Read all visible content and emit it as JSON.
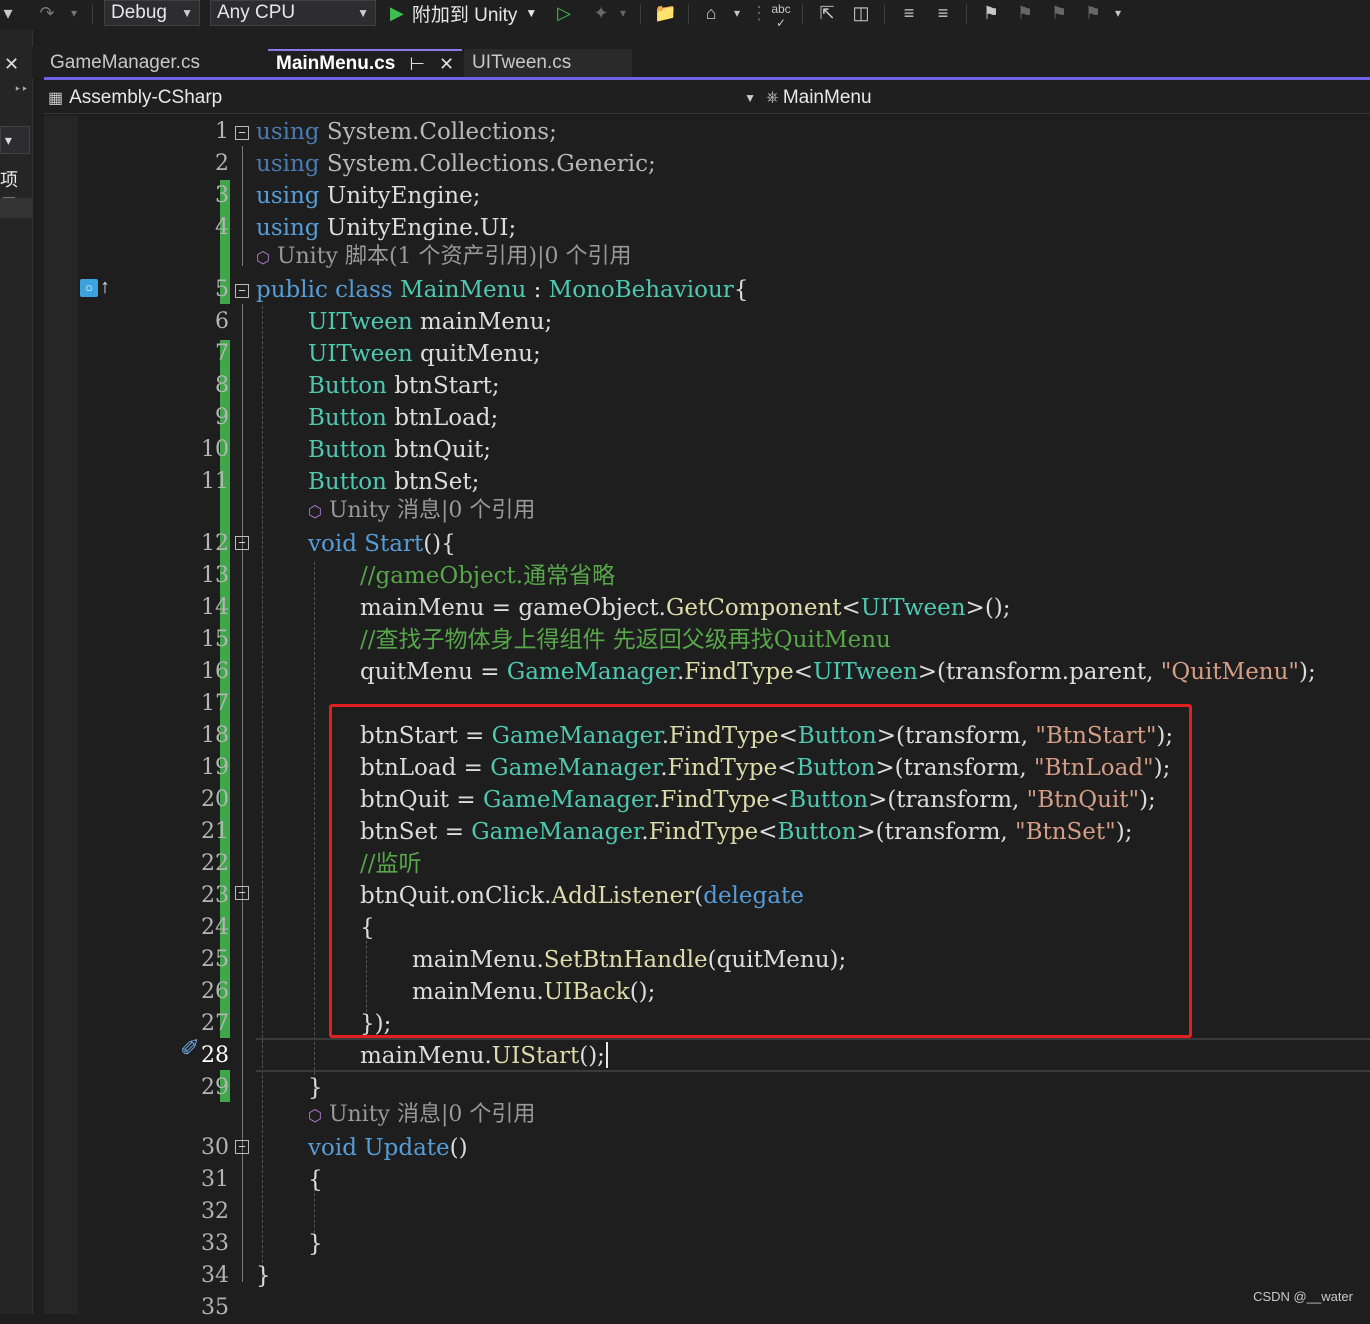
{
  "toolbar": {
    "config": "Debug",
    "platform": "Any CPU",
    "attach_label": "附加到 Unity"
  },
  "left_panel": {
    "label": "项目"
  },
  "tabs": [
    {
      "label": "GameManager.cs",
      "active": false
    },
    {
      "label": "MainMenu.cs",
      "active": true
    },
    {
      "label": "UITween.cs",
      "active": false
    }
  ],
  "navbar": {
    "project": "Assembly-CSharp",
    "class": "MainMenu"
  },
  "codelens": {
    "class_refs": "Unity 脚本(1 个资产引用)|0 个引用",
    "message_refs": "Unity 消息|0 个引用"
  },
  "editor": {
    "current_line": 28,
    "line_numbers": [
      "1",
      "2",
      "3",
      "4",
      "5",
      "6",
      "7",
      "8",
      "9",
      "10",
      "11",
      "12",
      "13",
      "14",
      "15",
      "16",
      "17",
      "18",
      "19",
      "20",
      "21",
      "22",
      "23",
      "24",
      "25",
      "26",
      "27",
      "28",
      "29",
      "30",
      "31",
      "32",
      "33",
      "34",
      "35"
    ]
  },
  "code": {
    "l1": [
      "using",
      "System.Collections;"
    ],
    "l2": [
      "using",
      "System.Collections.Generic;"
    ],
    "l3": [
      "using",
      "UnityEngine;"
    ],
    "l4": [
      "using",
      "UnityEngine.UI;"
    ],
    "l5": [
      "public",
      "class",
      "MainMenu",
      ":",
      "MonoBehaviour",
      "{"
    ],
    "l6": [
      "UITween",
      "mainMenu;"
    ],
    "l7": [
      "UITween",
      "quitMenu;"
    ],
    "l8": [
      "Button",
      "btnStart;"
    ],
    "l9": [
      "Button",
      "btnLoad;"
    ],
    "l10": [
      "Button",
      "btnQuit;"
    ],
    "l11": [
      "Button",
      "btnSet;"
    ],
    "l12": [
      "void",
      "Start",
      "(){"
    ],
    "l13": "//gameObject.通常省略",
    "l14": [
      "mainMenu = gameObject.",
      "GetComponent",
      "<",
      "UITween",
      ">();"
    ],
    "l15": "//查找子物体身上得组件 先返回父级再找QuitMenu",
    "l16": [
      "quitMenu = ",
      "GameManager",
      ".",
      "FindType",
      "<",
      "UITween",
      ">(transform.parent, ",
      "\"QuitMenu\"",
      ");"
    ],
    "l18": [
      "btnStart = ",
      "GameManager",
      ".",
      "FindType",
      "<",
      "Button",
      ">(transform, ",
      "\"BtnStart\"",
      ");"
    ],
    "l19": [
      "btnLoad = ",
      "GameManager",
      ".",
      "FindType",
      "<",
      "Button",
      ">(transform, ",
      "\"BtnLoad\"",
      ");"
    ],
    "l20": [
      "btnQuit = ",
      "GameManager",
      ".",
      "FindType",
      "<",
      "Button",
      ">(transform, ",
      "\"BtnQuit\"",
      ");"
    ],
    "l21": [
      "btnSet = ",
      "GameManager",
      ".",
      "FindType",
      "<",
      "Button",
      ">(transform, ",
      "\"BtnSet\"",
      ");"
    ],
    "l22": "//监听",
    "l23": [
      "btnQuit.onClick.",
      "AddListener",
      "(",
      "delegate"
    ],
    "l24": "{",
    "l25": [
      "mainMenu.",
      "SetBtnHandle",
      "(quitMenu);"
    ],
    "l26": [
      "mainMenu.",
      "UIBack",
      "();"
    ],
    "l27": "});",
    "l28": [
      "mainMenu.",
      "UIStart",
      "();"
    ],
    "l29": "}",
    "l30": [
      "void",
      "Update",
      "()"
    ],
    "l31": "{",
    "l33": "}",
    "l34": "}"
  },
  "watermark": "CSDN @__water",
  "colors": {
    "keyword": "#569cd6",
    "type": "#4ec9b0",
    "method": "#dcdcaa",
    "string": "#d69d85",
    "comment": "#57a64a",
    "accent": "#7160e8",
    "highlight_box": "#e41f1f",
    "change_bar": "#3fa64a"
  }
}
